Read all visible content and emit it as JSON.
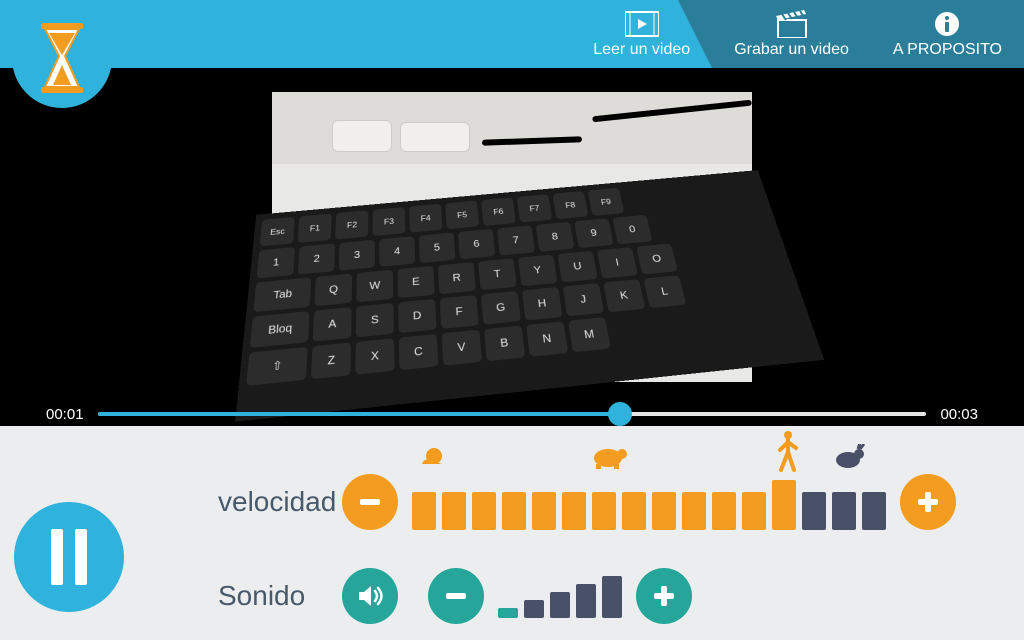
{
  "header": {
    "nav": {
      "read": "Leer un video",
      "record": "Grabar un video",
      "about": "A PROPOSITO"
    }
  },
  "player": {
    "current_time": "00:01",
    "total_time": "00:03",
    "progress_pct": 63
  },
  "controls": {
    "speed_label": "velocidad",
    "sound_label": "Sonido",
    "speed_value": 13,
    "speed_max": 16,
    "sound_value": 1,
    "sound_max": 5
  }
}
